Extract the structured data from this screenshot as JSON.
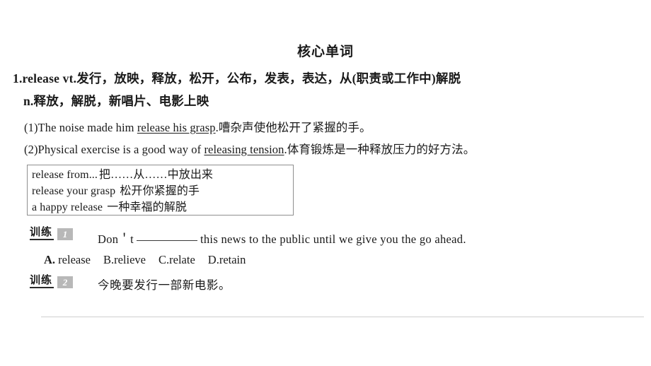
{
  "header": {
    "title": "核心单词"
  },
  "entry": {
    "number": "1.",
    "word": "release",
    "pos_vt": "vt.",
    "defs_vt": "发行，放映，释放，松开，公布，发表，表达，从(职责或工作中)解脱",
    "pos_n": "n.",
    "defs_n": "释放，解脱，新唱片、电影上映",
    "line1": "1.release vt.发行，放映，释放，松开，公布，发表，表达，从(职责或工作中)解脱",
    "line2": "n.释放，解脱，新唱片、电影上映"
  },
  "examples": [
    {
      "index": "(1)",
      "before": "The noise made him ",
      "underlined": "release his grasp",
      "after": ".",
      "translation": "嘈杂声使他松开了紧握的手。"
    },
    {
      "index": "(2)",
      "before": "Physical exercise is a good way of ",
      "underlined": "releasing tension",
      "after": ".",
      "translation": "体育锻炼是一种释放压力的好方法。"
    }
  ],
  "phrase_box": {
    "rows": [
      {
        "en": "release from...",
        "cn": "把……从……中放出来"
      },
      {
        "en": "release your grasp",
        "cn": "松开你紧握的手"
      },
      {
        "en": "a happy release",
        "cn": "一种幸福的解脱"
      }
    ]
  },
  "drills": [
    {
      "badge_label": "训练",
      "badge_num": "1",
      "question_before": "Don＇t",
      "question_after": "this news to the public until we give you the go ahead.",
      "options": [
        {
          "key": "A.",
          "text": " release",
          "bold": true
        },
        {
          "key": "B.",
          "text": "relieve",
          "bold": false
        },
        {
          "key": "C.",
          "text": "relate",
          "bold": false
        },
        {
          "key": "D.",
          "text": "retain",
          "bold": false
        }
      ]
    },
    {
      "badge_label": "训练",
      "badge_num": "2",
      "prompt": "今晚要发行一部新电影。"
    }
  ],
  "colors": {
    "text": "#1a1a1a",
    "badge_bg": "#b8b8b8",
    "badge_text": "#ffffff",
    "box_border": "#8f8f8f",
    "divider": "#cfcfcf",
    "background": "#ffffff"
  }
}
